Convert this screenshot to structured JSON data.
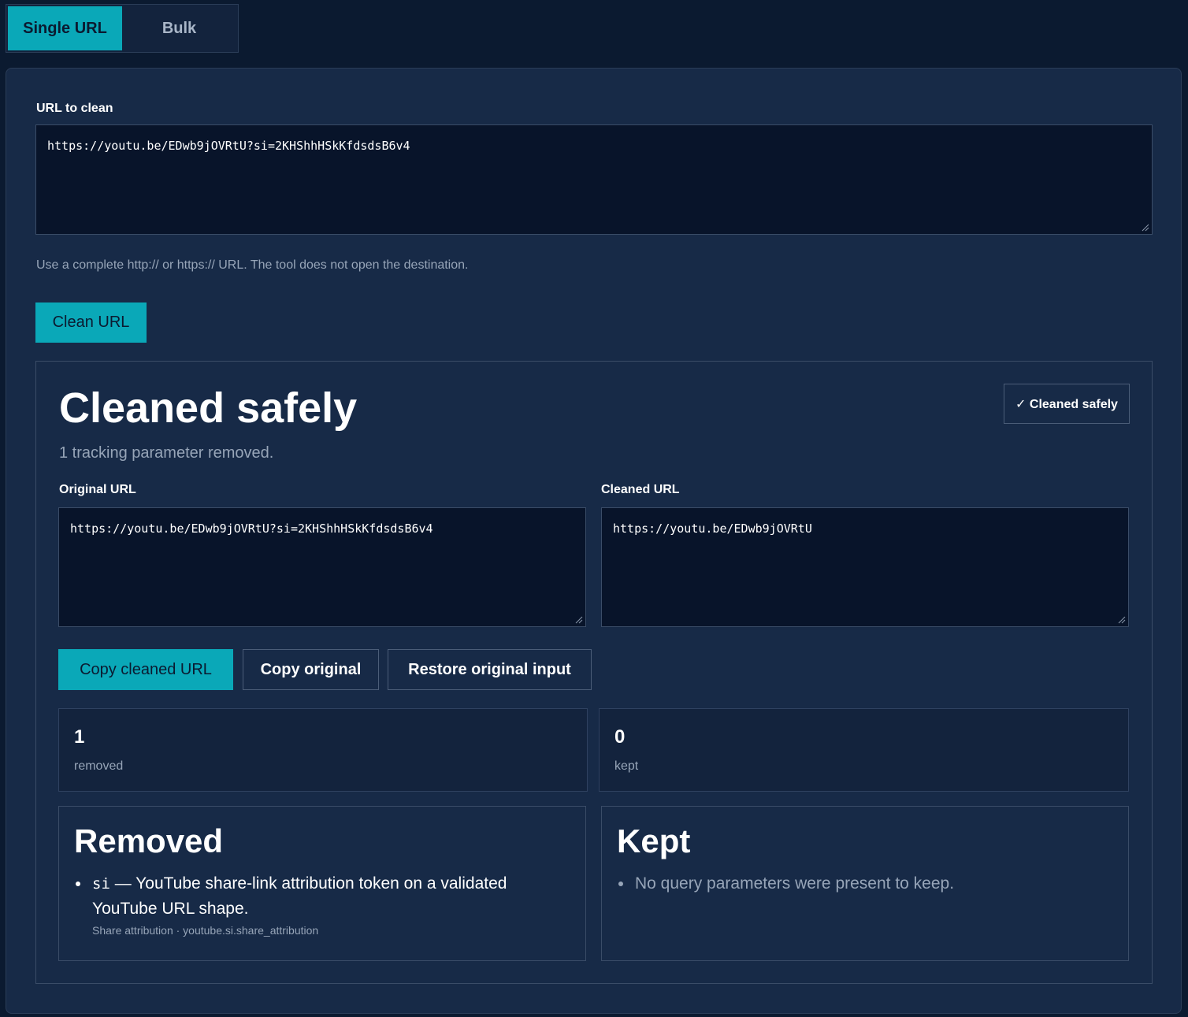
{
  "tabs": [
    {
      "label": "Single URL",
      "active": true
    },
    {
      "label": "Bulk",
      "active": false
    }
  ],
  "input": {
    "label": "URL to clean",
    "value": "https://youtu.be/EDwb9jOVRtU?si=2KHShhHSkKfdsdsB6v4",
    "hint": "Use a complete http:// or https:// URL. The tool does not open the destination.",
    "button": "Clean URL"
  },
  "result": {
    "title": "Cleaned safely",
    "subtitle": "1 tracking parameter removed.",
    "badge": "✓ Cleaned safely",
    "original_label": "Original URL",
    "original_value": "https://youtu.be/EDwb9jOVRtU?si=2KHShhHSkKfdsdsB6v4",
    "cleaned_label": "Cleaned URL",
    "cleaned_value": "https://youtu.be/EDwb9jOVRtU",
    "buttons": {
      "copy_cleaned": "Copy cleaned URL",
      "copy_original": "Copy original",
      "restore": "Restore original input"
    },
    "stats": {
      "removed_count": "1",
      "removed_label": "removed",
      "kept_count": "0",
      "kept_label": "kept"
    },
    "removed_card": {
      "title": "Removed",
      "param": "si",
      "description": " — YouTube share-link attribution token on a validated YouTube URL shape.",
      "meta": "Share attribution · youtube.si.share_attribution"
    },
    "kept_card": {
      "title": "Kept",
      "empty": "No query parameters were present to keep."
    }
  },
  "colors": {
    "accent": "#0aa8b8",
    "background": "#0b1a30",
    "panel": "#172a47"
  }
}
